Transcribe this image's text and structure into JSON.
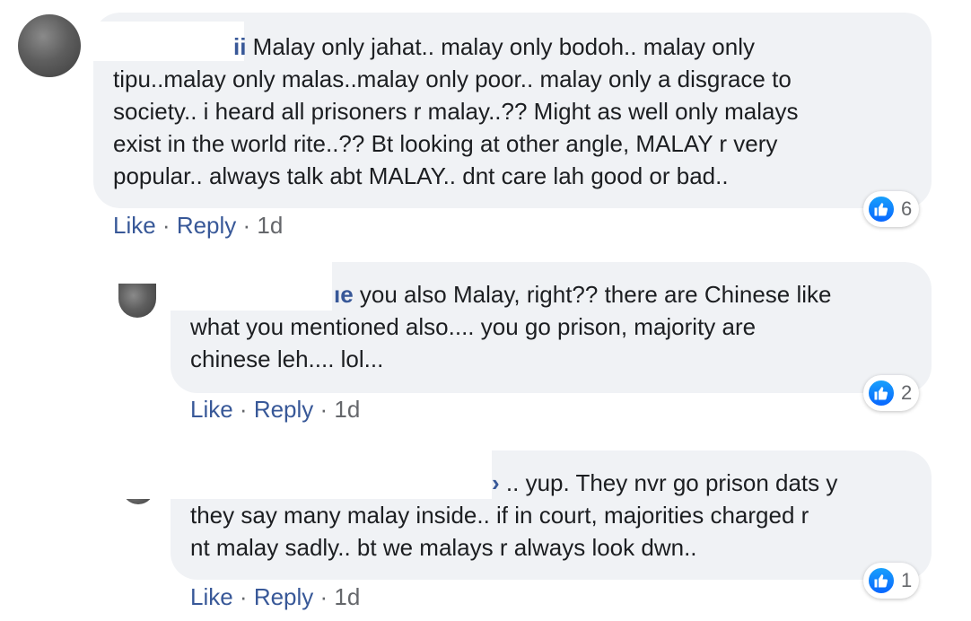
{
  "comments": [
    {
      "author_fragment": "ii",
      "lines": [
        " Malay only jahat.. malay only bodoh.. malay only",
        "tipu..malay only malas..malay only poor.. malay only a disgrace to",
        "society.. i heard all prisoners r malay..?? Might as well only malays",
        "exist in the world rite..?? Bt looking at other angle, MALAY r very",
        "popular.. always talk abt MALAY.. dnt care lah good or bad.."
      ],
      "reaction_count": "6",
      "like_label": "Like",
      "reply_label": "Reply",
      "time": "1d"
    },
    {
      "author_fragment": "ıe",
      "lines": [
        " you also Malay, right?? there are Chinese like",
        "what you mentioned also.... you go prison, majority are",
        "chinese leh.... lol..."
      ],
      "reaction_count": "2",
      "like_label": "Like",
      "reply_label": "Reply",
      "time": "1d"
    },
    {
      "author_fragment": "›",
      "lines": [
        " .. yup. They nvr go prison dats y",
        "they say many malay inside.. if in court, majorities charged r",
        "nt malay sadly.. bt we malays r always look dwn.."
      ],
      "reaction_count": "1",
      "like_label": "Like",
      "reply_label": "Reply",
      "time": "1d"
    }
  ],
  "separator": " · ",
  "colors": {
    "bubble": "#f0f2f5",
    "name": "#385898",
    "meta": "#65676b",
    "like_blue": "#0866ff"
  },
  "icons": [
    "like-icon",
    "avatar"
  ]
}
